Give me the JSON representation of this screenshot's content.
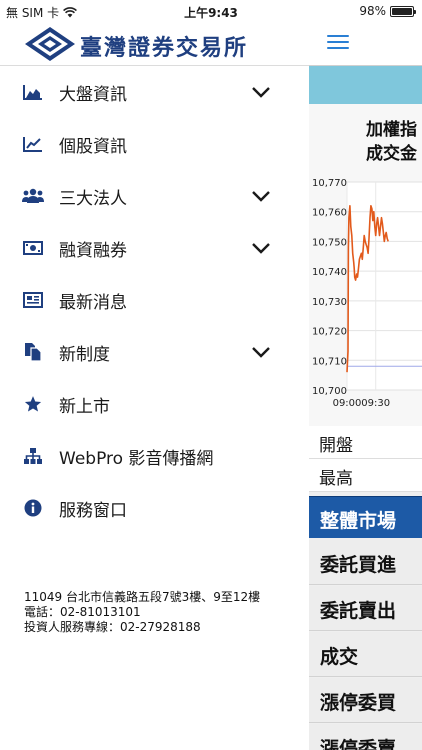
{
  "status_bar": {
    "carrier": "無 SIM 卡",
    "time": "上午9:43",
    "battery": "98%",
    "battery_level": 0.98
  },
  "drawer": {
    "logo_text": "臺灣證券交易所",
    "menu": [
      {
        "label": "大盤資訊",
        "icon": "area-chart-icon",
        "expandable": true
      },
      {
        "label": "個股資訊",
        "icon": "line-chart-icon",
        "expandable": false
      },
      {
        "label": "三大法人",
        "icon": "users-icon",
        "expandable": true
      },
      {
        "label": "融資融券",
        "icon": "money-icon",
        "expandable": true
      },
      {
        "label": "最新消息",
        "icon": "newspaper-icon",
        "expandable": false
      },
      {
        "label": "新制度",
        "icon": "copy-icon",
        "expandable": true
      },
      {
        "label": "新上市",
        "icon": "star-icon",
        "expandable": false
      },
      {
        "label": "WebPro 影音傳播網",
        "icon": "sitemap-icon",
        "expandable": false
      },
      {
        "label": "服務窗口",
        "icon": "info-icon",
        "expandable": false
      }
    ],
    "address_lines": [
      "11049 台北市信義路五段7號3樓、9至12樓",
      "電話：02-81013101",
      "投資人服務專線：02-27928188"
    ]
  },
  "main": {
    "chart_title_line1": "加權指",
    "chart_title_line2": "成交金",
    "stats": [
      "開盤",
      "最高"
    ],
    "section_head": "整體市場",
    "categories": [
      "委託買進",
      "委託賣出",
      "成交",
      "漲停委買",
      "漲停委賣"
    ]
  },
  "colors": {
    "accent": "#2a7fd4",
    "brand": "#1f3f80",
    "line": "#e25a1c",
    "section": "#1d5aa6",
    "band": "#7fc7dc"
  },
  "chart_data": {
    "type": "line",
    "ylim": [
      10700,
      10770
    ],
    "y_ticks": [
      "10,770",
      "10,760",
      "10,750",
      "10,740",
      "10,730",
      "10,720",
      "10,710",
      "10,700"
    ],
    "y_tick_values": [
      10770,
      10760,
      10750,
      10740,
      10730,
      10720,
      10710,
      10700
    ],
    "x_ticks": [
      "09:00",
      "09:30"
    ],
    "x_tick_values": [
      0,
      30
    ],
    "reference_value": 10708,
    "series": [
      {
        "x": [
          0,
          1,
          1.5,
          2,
          3,
          4,
          5,
          6,
          7,
          7.5,
          8,
          9,
          10,
          11,
          12,
          13,
          14,
          15,
          16,
          17,
          18,
          19,
          20,
          21,
          22,
          23,
          24,
          25,
          26,
          27,
          28,
          29,
          30,
          31,
          32,
          33,
          34,
          35,
          36,
          37,
          38,
          39,
          40,
          41,
          42,
          43
        ],
        "y": [
          10706,
          10713,
          10748,
          10758,
          10762,
          10755,
          10752,
          10746,
          10743,
          10741,
          10738,
          10737,
          10739,
          10738,
          10741,
          10744,
          10745,
          10746,
          10744,
          10748,
          10752,
          10750,
          10749,
          10748,
          10746,
          10751,
          10758,
          10762,
          10761,
          10757,
          10760,
          10755,
          10752,
          10756,
          10758,
          10755,
          10752,
          10755,
          10758,
          10756,
          10753,
          10750,
          10752,
          10753,
          10751,
          10750
        ]
      }
    ]
  }
}
